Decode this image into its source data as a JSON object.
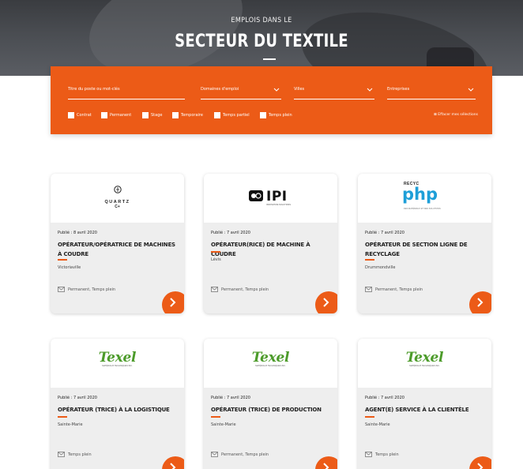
{
  "hero": {
    "subtitle": "EMPLOIS DANS LE",
    "title": "SECTEUR DU TEXTILE"
  },
  "filters": {
    "search_placeholder": "Titre du poste ou mot-clés",
    "domain_label": "Domaines d'emploi",
    "city_label": "Villes",
    "company_label": "Entreprises",
    "checkboxes": [
      "Contrat",
      "Permanent",
      "Stage",
      "Temporaire",
      "Temps partiel",
      "Temps plein"
    ],
    "clear_label": "Effacer mes sélections",
    "clear_prefix": "⊠"
  },
  "logos": {
    "quartz": {
      "name": "QUARTZ",
      "sub": "C+"
    },
    "ipi": {
      "name": "IPI",
      "tagline": "INNOVATIVE SOLUTIONS"
    },
    "php": {
      "top": "RECYC",
      "word": "php",
      "tagline": "DES MATÉRIAUX ET DES SOLUTIONS"
    },
    "texel": {
      "name": "Texel",
      "tagline": "MATÉRIAUX TECHNIQUES INC."
    }
  },
  "jobs": [
    {
      "date": "Publié : 8 avril 2020",
      "title": "OPÉRATEUR/OPÉRATRICE DE MACHINES À COUDRE",
      "location": "Victoriaville",
      "type": "Permanent, Temps plein"
    },
    {
      "date": "Publié : 7 avril 2020",
      "title": "OPÉRATEUR(RICE) DE MACHINE À COUDRE",
      "location": "Lévis",
      "type": "Permanent, Temps plein"
    },
    {
      "date": "Publié : 7 avril 2020",
      "title": "OPÉRATEUR DE SECTION LIGNE DE RECYCLAGE",
      "location": "Drummondville",
      "type": "Permanent, Temps plein"
    },
    {
      "date": "Publié : 7 avril 2020",
      "title": "OPÉRATEUR (TRICE) À LA LOGISTIQUE",
      "location": "Sainte-Marie",
      "type": "Temps plein"
    },
    {
      "date": "Publié : 7 avril 2020",
      "title": "OPÉRATEUR (TRICE) DE PRODUCTION",
      "location": "Sainte-Marie",
      "type": "Permanent, Temps plein"
    },
    {
      "date": "Publié : 7 avril 2020",
      "title": "AGENT(E) SERVICE À LA CLIENTÈLE",
      "location": "Sainte-Marie",
      "type": "Temps plein"
    }
  ],
  "colors": {
    "accent": "#ec5b17",
    "card_bg": "#eeeeee",
    "texel_green": "#4c9b2a",
    "php_blue": "#1e9fd8"
  }
}
